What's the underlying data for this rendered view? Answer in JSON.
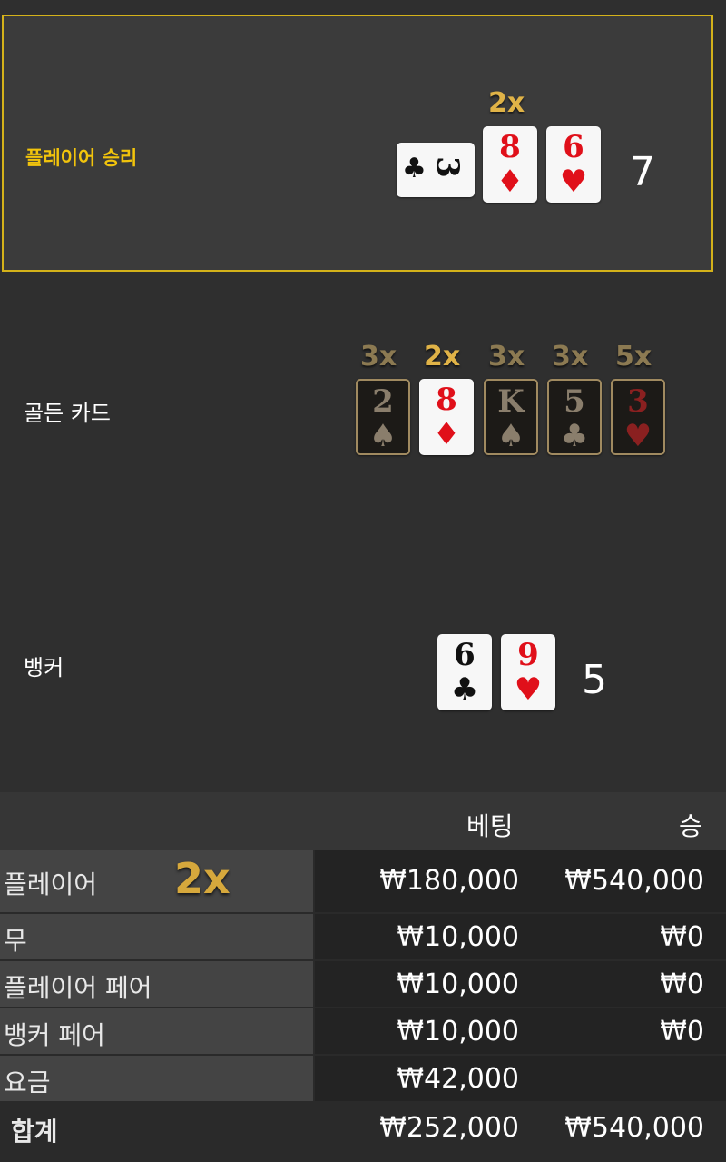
{
  "player": {
    "result_label": "플레이어 승리",
    "score": "7",
    "cards": [
      {
        "rank": "3",
        "suit": "♣",
        "color": "black",
        "orientation": "sideways"
      },
      {
        "rank": "8",
        "suit": "♦",
        "color": "red",
        "multiplier": "2x"
      },
      {
        "rank": "6",
        "suit": "♥",
        "color": "red"
      }
    ]
  },
  "golden": {
    "label": "골든 카드",
    "cards": [
      {
        "rank": "2",
        "suit": "♠",
        "multiplier": "3x",
        "active": false
      },
      {
        "rank": "8",
        "suit": "♦",
        "multiplier": "2x",
        "active": true
      },
      {
        "rank": "K",
        "suit": "♠",
        "multiplier": "3x",
        "active": false
      },
      {
        "rank": "5",
        "suit": "♣",
        "multiplier": "3x",
        "active": false
      },
      {
        "rank": "3",
        "suit": "♥",
        "multiplier": "5x",
        "active": false
      }
    ]
  },
  "banker": {
    "label": "뱅커",
    "score": "5",
    "cards": [
      {
        "rank": "6",
        "suit": "♣",
        "color": "black"
      },
      {
        "rank": "9",
        "suit": "♥",
        "color": "red"
      }
    ]
  },
  "table": {
    "header_bet": "베팅",
    "header_win": "승",
    "rows": [
      {
        "label": "플레이어",
        "multiplier": "2x",
        "bet": "₩180,000",
        "win": "₩540,000"
      },
      {
        "label": "무",
        "bet": "₩10,000",
        "win": "₩0"
      },
      {
        "label": "플레이어 페어",
        "bet": "₩10,000",
        "win": "₩0"
      },
      {
        "label": "뱅커 페어",
        "bet": "₩10,000",
        "win": "₩0"
      },
      {
        "label": "요금",
        "bet": "₩42,000",
        "win": ""
      },
      {
        "label": "합계",
        "bet": "₩252,000",
        "win": "₩540,000"
      }
    ]
  }
}
